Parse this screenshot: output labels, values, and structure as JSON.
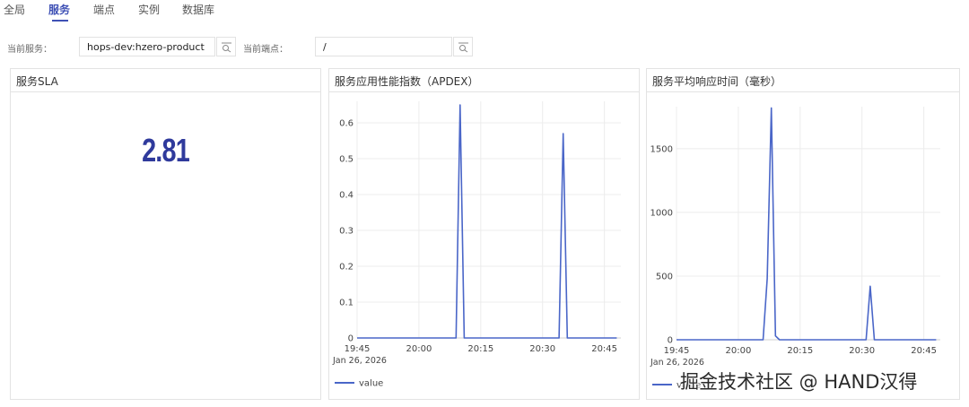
{
  "tabs": [
    {
      "label": "全局",
      "active": false
    },
    {
      "label": "服务",
      "active": true
    },
    {
      "label": "端点",
      "active": false
    },
    {
      "label": "实例",
      "active": false
    },
    {
      "label": "数据库",
      "active": false
    }
  ],
  "filters": {
    "service_label": "当前服务：",
    "service_value": "hops-dev:hzero-product",
    "endpoint_label": "当前端点：",
    "endpoint_value": "/"
  },
  "panels": {
    "sla": {
      "title": "服务SLA",
      "value": "2.81"
    },
    "apdex": {
      "title": "服务应用性能指数（APDEX）"
    },
    "response": {
      "title": "服务平均响应时间（毫秒）"
    }
  },
  "colors": {
    "accent": "#3f51b5",
    "series": "#4a66c8",
    "sla": "#2f3a9c"
  },
  "chart_data": [
    {
      "type": "line",
      "title": "服务应用性能指数（APDEX）",
      "xlabel": "",
      "ylabel": "",
      "x_tick_labels": [
        "19:45",
        "20:00",
        "20:15",
        "20:30",
        "20:45"
      ],
      "x_date_label": "Jan 26, 2026",
      "x_ticks_minutes": [
        0,
        15,
        30,
        45,
        60
      ],
      "xlim_minutes": [
        0,
        64
      ],
      "y_ticks": [
        0,
        0.1,
        0.2,
        0.3,
        0.4,
        0.5,
        0.6
      ],
      "ylim": [
        0,
        0.66
      ],
      "grid": true,
      "legend_position": "bottom-left",
      "series": [
        {
          "name": "value",
          "x_minutes": [
            0,
            24,
            25,
            26,
            49,
            50,
            51,
            63
          ],
          "values": [
            0,
            0,
            0.65,
            0,
            0,
            0.57,
            0,
            0
          ]
        }
      ]
    },
    {
      "type": "line",
      "title": "服务平均响应时间（毫秒）",
      "xlabel": "",
      "ylabel": "",
      "x_tick_labels": [
        "19:45",
        "20:00",
        "20:15",
        "20:30",
        "20:45"
      ],
      "x_date_label": "Jan 26, 2026",
      "x_ticks_minutes": [
        0,
        15,
        30,
        45,
        60
      ],
      "xlim_minutes": [
        0,
        64
      ],
      "y_ticks": [
        0,
        500,
        1000,
        1500
      ],
      "ylim": [
        0,
        1830
      ],
      "grid": true,
      "legend_position": "bottom-left",
      "series": [
        {
          "name": "value",
          "x_minutes": [
            0,
            21,
            22,
            23,
            24,
            25,
            46,
            47,
            48,
            63
          ],
          "values": [
            0,
            0,
            480,
            1820,
            30,
            0,
            0,
            420,
            0,
            0
          ]
        }
      ]
    }
  ],
  "watermark": "掘金技术社区 @ HAND汉得"
}
